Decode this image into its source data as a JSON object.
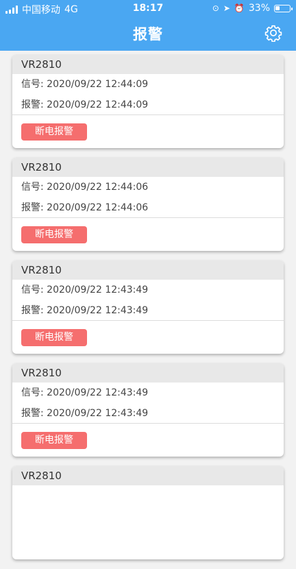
{
  "status_bar": {
    "carrier": "中国移动",
    "network": "4G",
    "time": "18:17",
    "battery": "33%",
    "battery_level": 0.33
  },
  "header": {
    "title": "报警",
    "settings_icon": "gear-icon"
  },
  "alarms": [
    {
      "device": "VR2810",
      "signal_label": "信号:",
      "signal_time": "2020/09/22 12:44:09",
      "alarm_label": "报警:",
      "alarm_time": "2020/09/22 12:44:09",
      "action_label": "断电报警"
    },
    {
      "device": "VR2810",
      "signal_label": "信号:",
      "signal_time": "2020/09/22 12:44:06",
      "alarm_label": "报警:",
      "alarm_time": "2020/09/22 12:44:06",
      "action_label": "断电报警"
    },
    {
      "device": "VR2810",
      "signal_label": "信号:",
      "signal_time": "2020/09/22 12:43:49",
      "alarm_label": "报警:",
      "alarm_time": "2020/09/22 12:43:49",
      "action_label": "断电报警"
    },
    {
      "device": "VR2810",
      "signal_label": "信号:",
      "signal_time": "2020/09/22 12:43:49",
      "alarm_label": "报警:",
      "alarm_time": "2020/09/22 12:43:49",
      "action_label": "断电报警"
    },
    {
      "device": "VR2810"
    }
  ],
  "colors": {
    "header_bg": "#4aa7f2",
    "alarm_button": "#f56e6e",
    "card_header_bg": "#e8e8e8",
    "page_bg": "#f2f2f2"
  }
}
